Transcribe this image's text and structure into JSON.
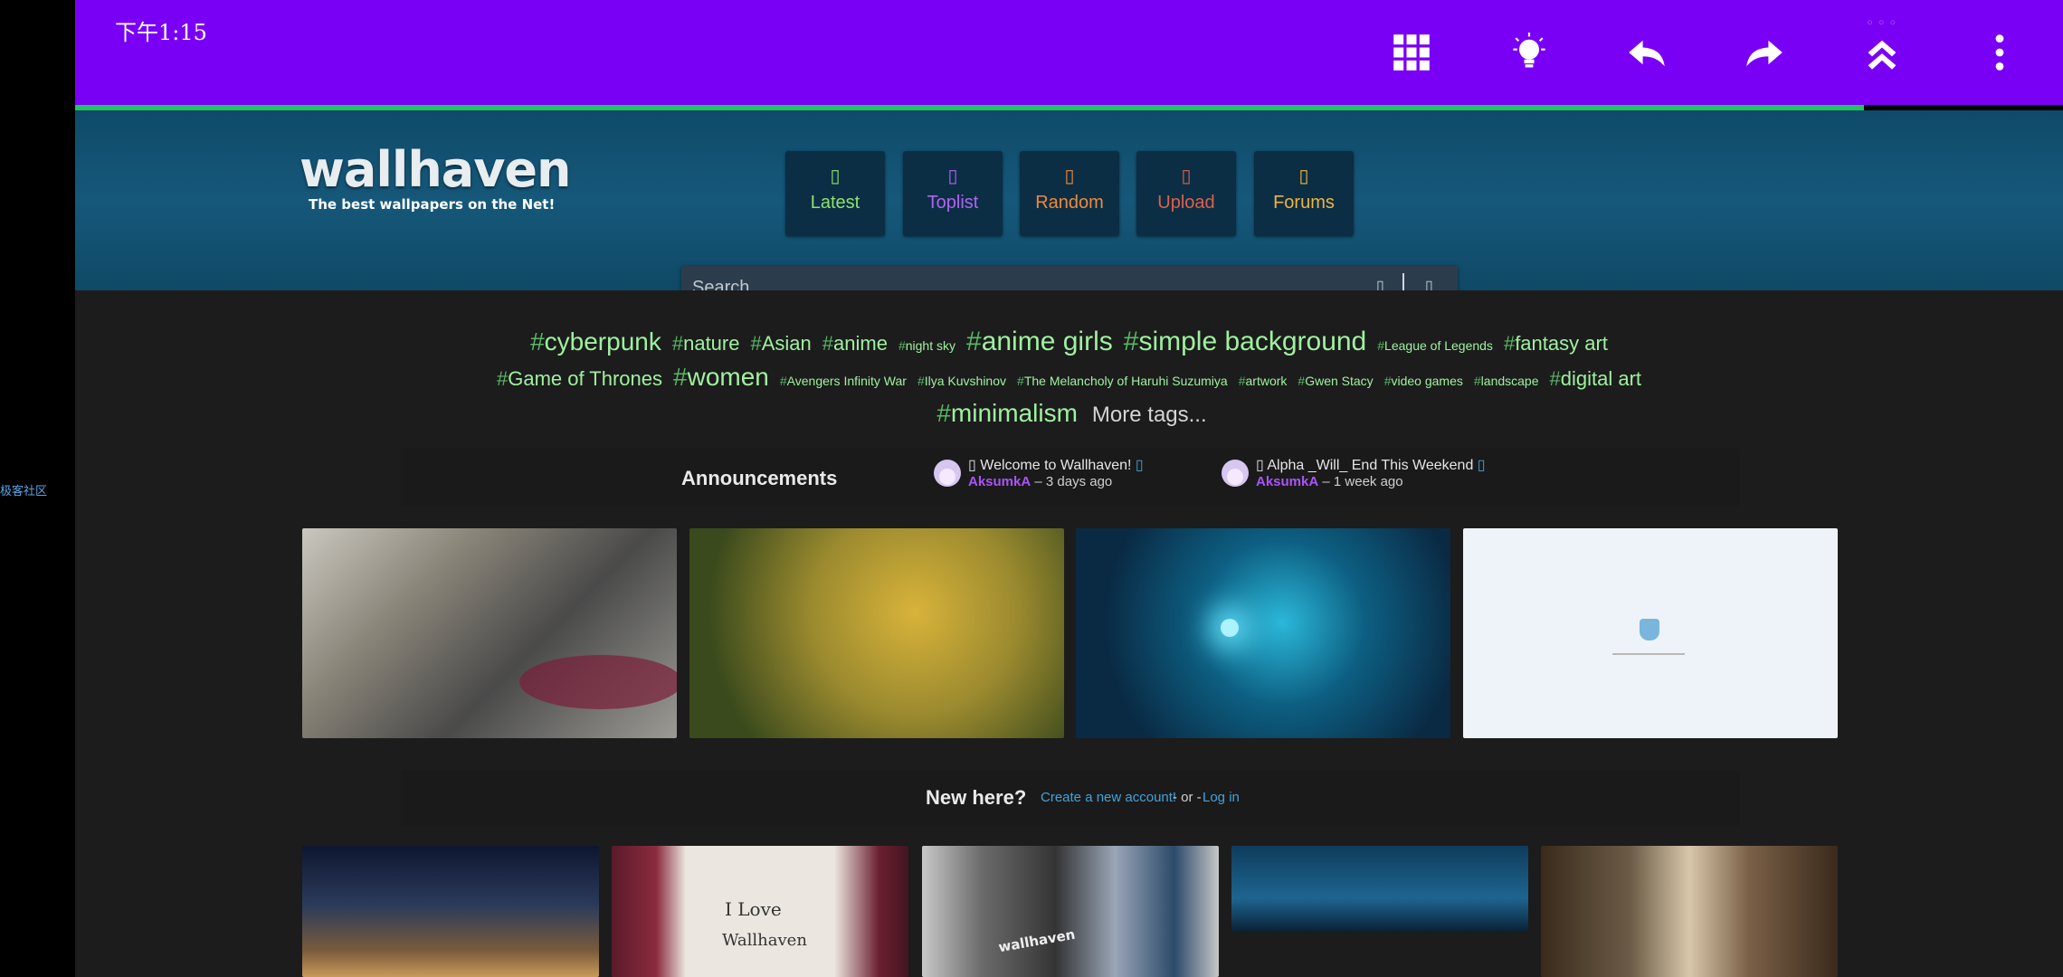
{
  "status": {
    "time": "下午1:15"
  },
  "side": {
    "label": "极客社区"
  },
  "toolbar": {
    "buttons": [
      {
        "name": "apps-grid-button",
        "icon": "grid-icon"
      },
      {
        "name": "idea-button",
        "icon": "lightbulb-icon"
      },
      {
        "name": "back-button",
        "icon": "back-arrow-icon"
      },
      {
        "name": "forward-button",
        "icon": "forward-arrow-icon"
      },
      {
        "name": "scroll-top-button",
        "icon": "double-chevron-up-icon"
      },
      {
        "name": "more-button",
        "icon": "more-vertical-icon"
      }
    ],
    "progress_fraction": 0.9
  },
  "header": {
    "logo": "wallhaven",
    "tagline": "The best wallpapers on the Net!",
    "nav": [
      {
        "label": "Latest",
        "color": "#8fe36b"
      },
      {
        "label": "Toplist",
        "color": "#b462f5"
      },
      {
        "label": "Random",
        "color": "#f0893a"
      },
      {
        "label": "Upload",
        "color": "#e0604a"
      },
      {
        "label": "Forums",
        "color": "#f0b43c"
      }
    ]
  },
  "search": {
    "placeholder": "Search..."
  },
  "tags": {
    "row1": [
      {
        "text": "cyberpunk",
        "size": 28
      },
      {
        "text": "nature",
        "size": 22
      },
      {
        "text": "Asian",
        "size": 22
      },
      {
        "text": "anime",
        "size": 22
      },
      {
        "text": "night sky",
        "size": 14
      },
      {
        "text": "anime girls",
        "size": 30
      },
      {
        "text": "simple background",
        "size": 30
      },
      {
        "text": "League of Legends",
        "size": 14
      },
      {
        "text": "fantasy art",
        "size": 22
      }
    ],
    "row2": [
      {
        "text": "Game of Thrones",
        "size": 22
      },
      {
        "text": "women",
        "size": 28
      },
      {
        "text": "Avengers Infinity War",
        "size": 14
      },
      {
        "text": "Ilya Kuvshinov",
        "size": 14
      },
      {
        "text": "The Melancholy of Haruhi Suzumiya",
        "size": 14
      },
      {
        "text": "artwork",
        "size": 14
      },
      {
        "text": "Gwen Stacy",
        "size": 14
      },
      {
        "text": "video games",
        "size": 14
      },
      {
        "text": "landscape",
        "size": 14
      },
      {
        "text": "digital art",
        "size": 22
      }
    ],
    "row3": [
      {
        "text": "minimalism",
        "size": 28
      }
    ],
    "more_label": "More tags..."
  },
  "announcements": {
    "title": "Announcements",
    "items": [
      {
        "title": "Welcome to Wallhaven!",
        "user": "AksumkA",
        "time": "– 3 days ago"
      },
      {
        "title": "Alpha _Will_ End This Weekend",
        "user": "AksumkA",
        "time": "– 1 week ago"
      }
    ]
  },
  "new_here": {
    "title": "New here?",
    "create": "Create a new account!",
    "or": " - or - ",
    "login": "Log in"
  },
  "featured_wallpapers": [
    {
      "name": "cyberpunk-girl-wallpaper"
    },
    {
      "name": "giant-hands-wallpaper"
    },
    {
      "name": "underwater-creature-wallpaper"
    },
    {
      "name": "minimal-light-wallpaper"
    }
  ],
  "bottom_wallpapers": [
    {
      "name": "milky-way-mountain-wallpaper"
    },
    {
      "name": "i-love-wallhaven-wallpaper",
      "line1": "I Love",
      "line2": "Wallhaven"
    },
    {
      "name": "graffiti-wallpaper",
      "mark": "wallhaven"
    },
    {
      "name": "highway-interchange-wallpaper"
    },
    {
      "name": "forest-light-wallpaper"
    }
  ]
}
